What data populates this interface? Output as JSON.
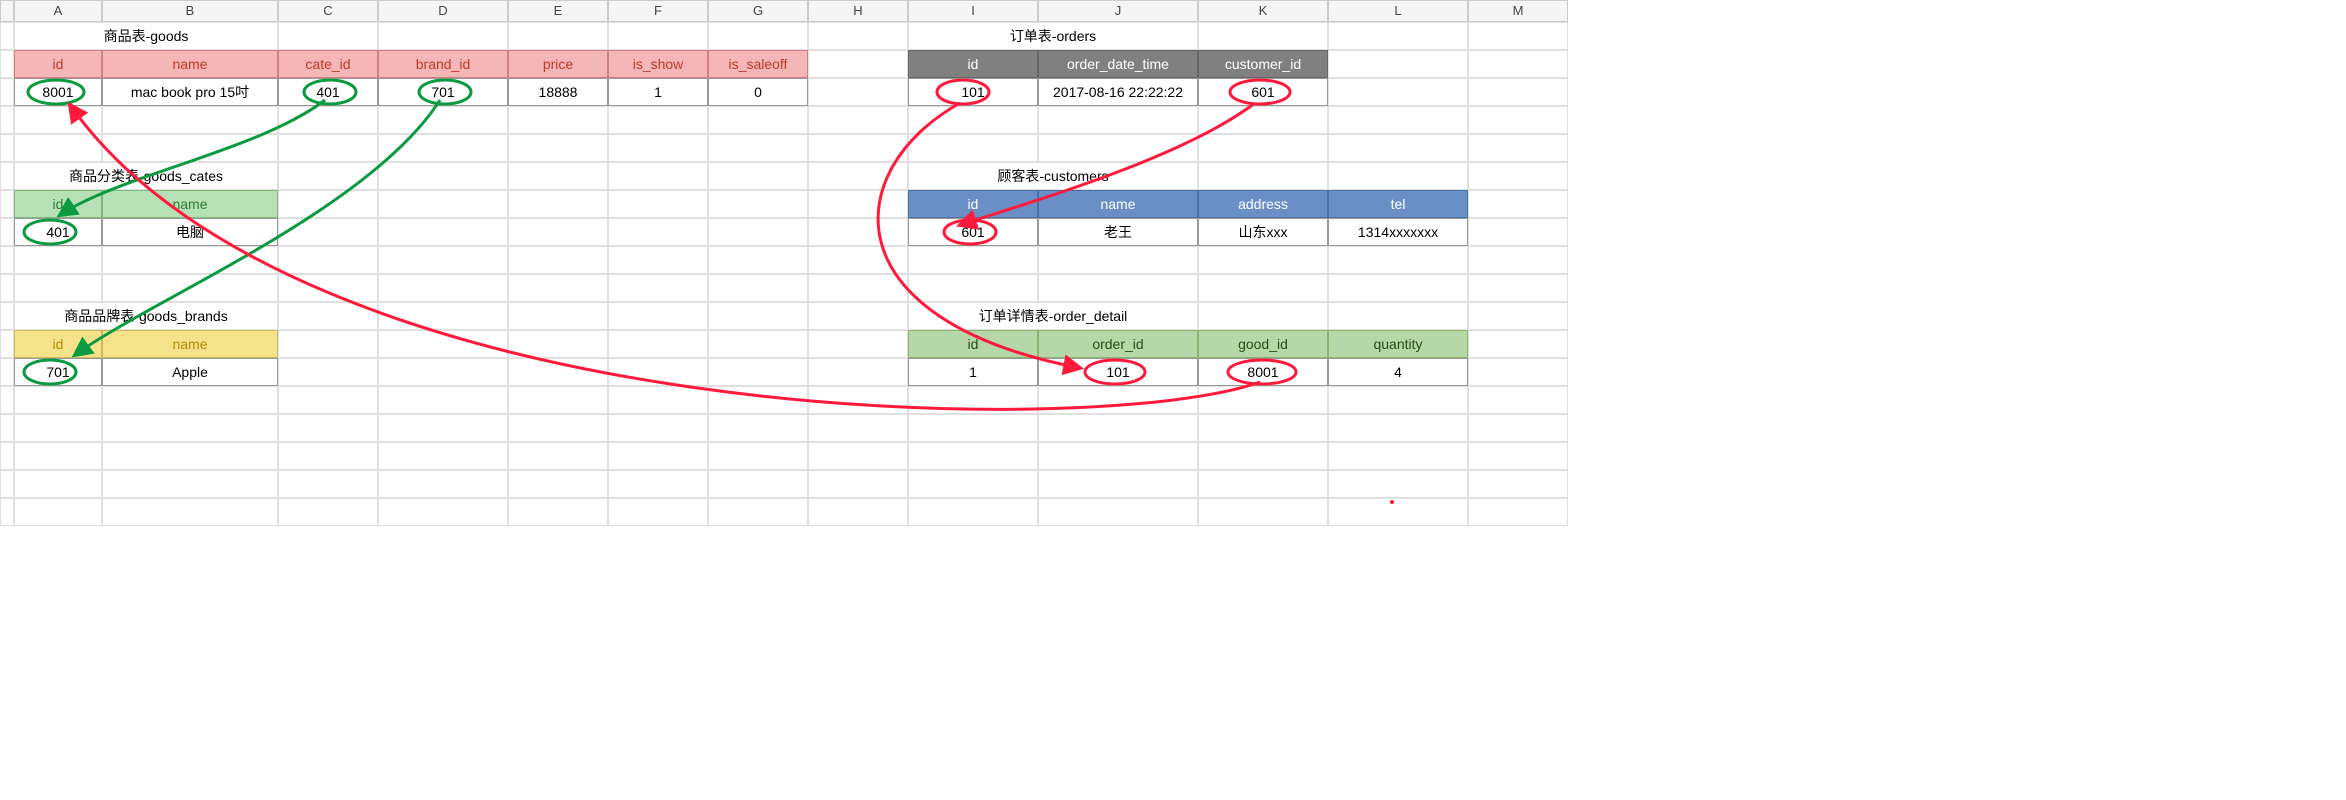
{
  "columns": [
    "A",
    "B",
    "C",
    "D",
    "E",
    "F",
    "G",
    "H",
    "I",
    "J",
    "K",
    "L",
    "M"
  ],
  "goods": {
    "title": "商品表-goods",
    "headers": [
      "id",
      "name",
      "cate_id",
      "brand_id",
      "price",
      "is_show",
      "is_saleoff"
    ],
    "row": {
      "id": "8001",
      "name": "mac book pro 15吋",
      "cate_id": "401",
      "brand_id": "701",
      "price": "18888",
      "is_show": "1",
      "is_saleoff": "0"
    }
  },
  "orders": {
    "title": "订单表-orders",
    "headers": [
      "id",
      "order_date_time",
      "customer_id"
    ],
    "row": {
      "id": "101",
      "order_date_time": "2017-08-16 22:22:22",
      "customer_id": "601"
    }
  },
  "goods_cates": {
    "title": "商品分类表-goods_cates",
    "headers": [
      "id",
      "name"
    ],
    "row": {
      "id": "401",
      "name": "电脑"
    }
  },
  "customers": {
    "title": "顾客表-customers",
    "headers": [
      "id",
      "name",
      "address",
      "tel"
    ],
    "row": {
      "id": "601",
      "name": "老王",
      "address": "山东xxx",
      "tel": "1314xxxxxxx"
    }
  },
  "goods_brands": {
    "title": "商品品牌表-goods_brands",
    "headers": [
      "id",
      "name"
    ],
    "row": {
      "id": "701",
      "name": "Apple"
    }
  },
  "order_detail": {
    "title": "订单详情表-order_detail",
    "headers": [
      "id",
      "order_id",
      "good_id",
      "quantity"
    ],
    "row": {
      "id": "1",
      "order_id": "101",
      "good_id": "8001",
      "quantity": "4"
    }
  }
}
